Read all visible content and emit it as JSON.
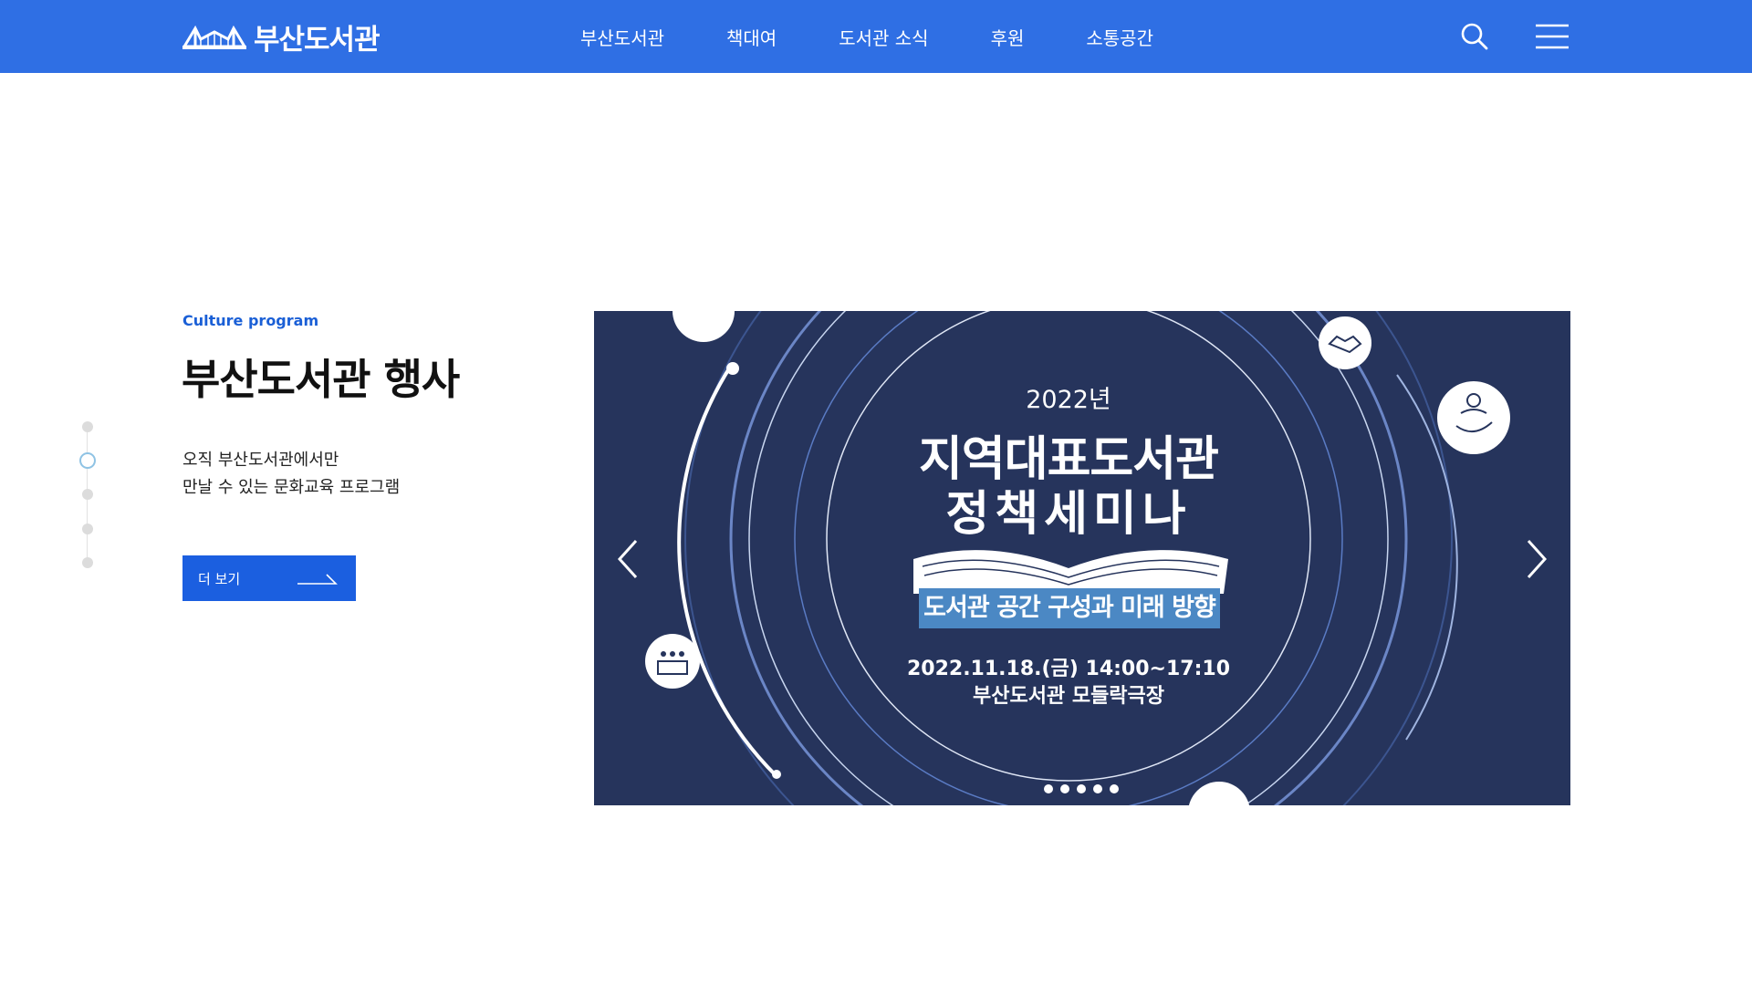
{
  "header": {
    "logo_text": "부산도서관",
    "nav": [
      "부산도서관",
      "책대여",
      "도서관 소식",
      "후원",
      "소통공간"
    ]
  },
  "section": {
    "eyebrow": "Culture program",
    "title": "부산도서관 행사",
    "desc_line1": "오직 부산도서관에서만",
    "desc_line2": "만날 수 있는 문화교육 프로그램",
    "more_label": "더 보기"
  },
  "banner": {
    "year": "2022년",
    "title_line1": "지역대표도서관",
    "title_line2": "정책세미나",
    "subtitle": "도서관 공간 구성과 미래 방향",
    "date": "2022.11.18.(금) 14:00~17:10",
    "place": "부산도서관 모들락극장",
    "slide_count": 5
  },
  "side_pager": {
    "count": 5,
    "active_index": 1
  },
  "colors": {
    "header_bg": "#2f6fe4",
    "accent": "#1b5fe0",
    "banner_bg": "#26345c",
    "banner_subtitle_bg": "#4b88c4"
  },
  "icons": [
    "library-bridge-logo-icon",
    "search-icon",
    "hamburger-menu-icon",
    "arrow-right-icon",
    "chevron-left-icon",
    "chevron-right-icon",
    "handshake-icon",
    "care-hand-icon",
    "meeting-icon",
    "open-book-icon"
  ]
}
